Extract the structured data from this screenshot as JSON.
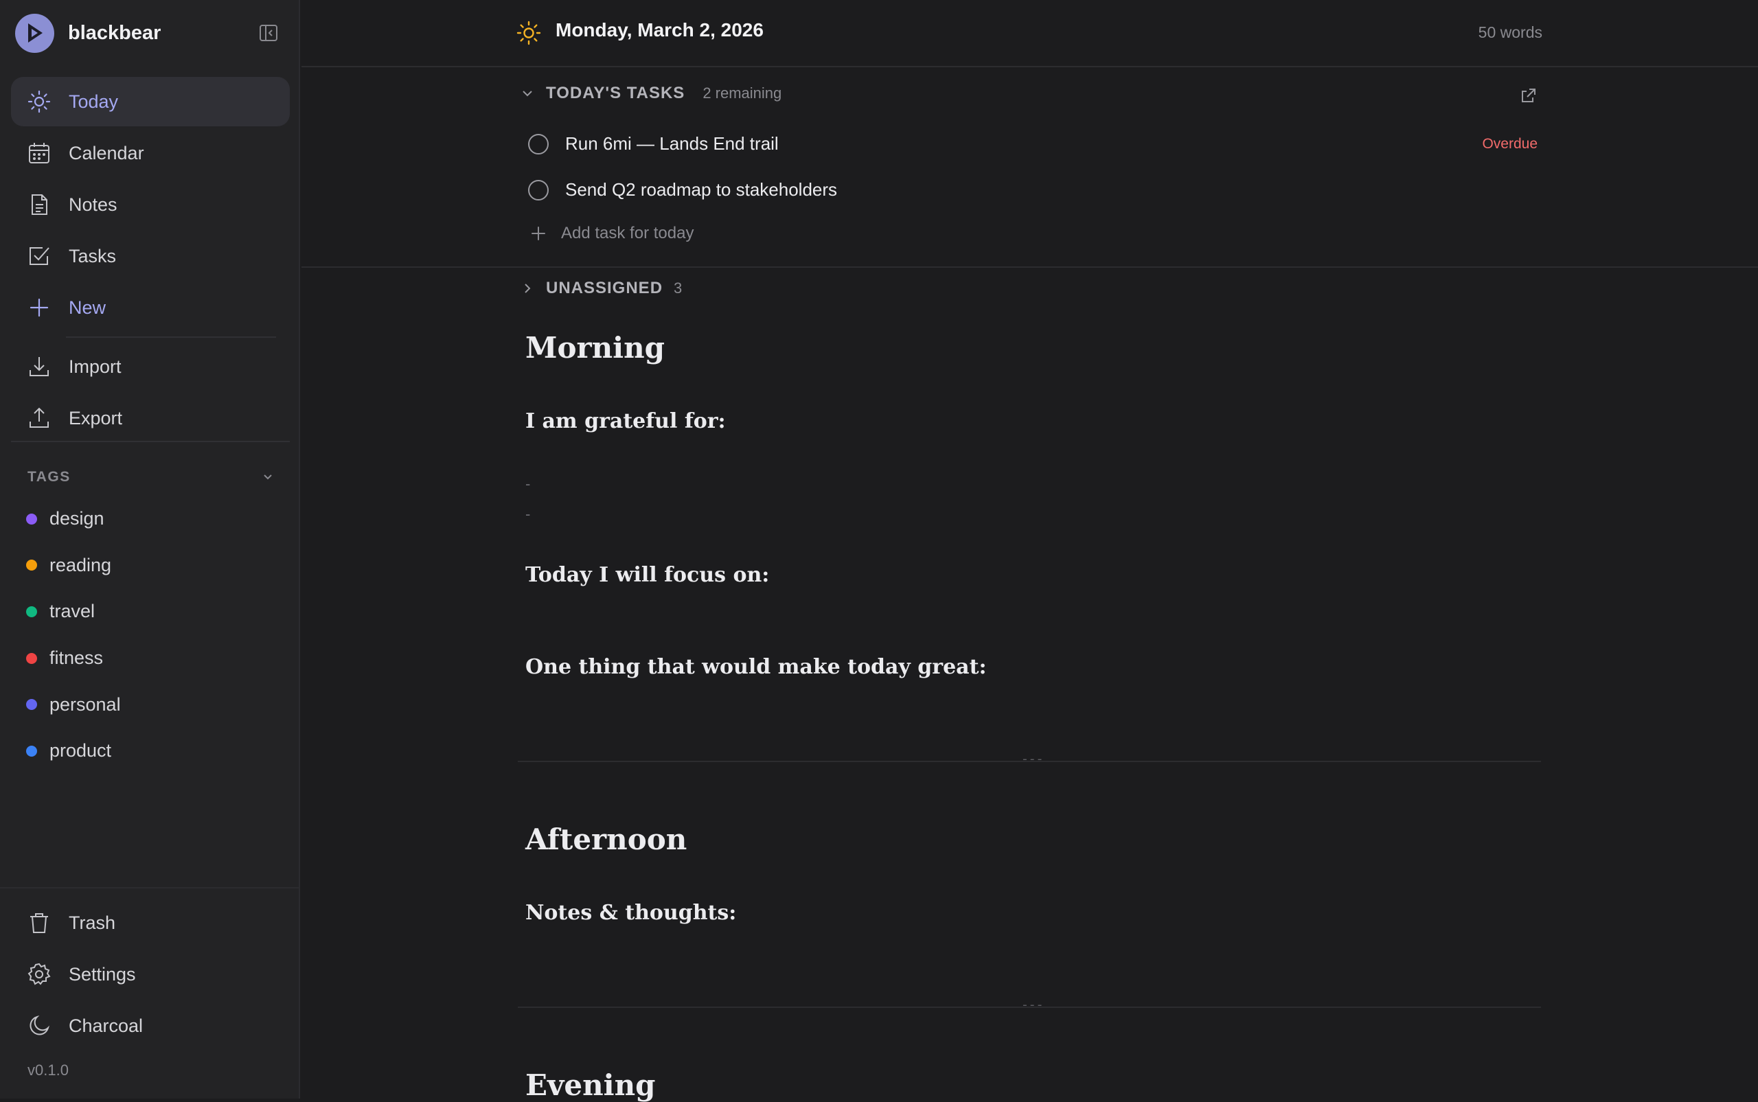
{
  "app": {
    "name": "blackbear",
    "version": "v0.1.0"
  },
  "sidebar": {
    "nav": [
      {
        "label": "Today",
        "icon": "sun-icon",
        "active": true
      },
      {
        "label": "Calendar",
        "icon": "calendar-icon"
      },
      {
        "label": "Notes",
        "icon": "document-icon"
      },
      {
        "label": "Tasks",
        "icon": "checkbox-icon"
      },
      {
        "label": "New",
        "icon": "plus-icon"
      },
      {
        "label": "Import",
        "icon": "download-icon"
      },
      {
        "label": "Export",
        "icon": "upload-icon"
      }
    ],
    "tags_header": "TAGS",
    "tags": [
      {
        "label": "design",
        "color": "#8b5cf6"
      },
      {
        "label": "reading",
        "color": "#f59e0b"
      },
      {
        "label": "travel",
        "color": "#10b981"
      },
      {
        "label": "fitness",
        "color": "#ef4444"
      },
      {
        "label": "personal",
        "color": "#6366f1"
      },
      {
        "label": "product",
        "color": "#3b82f6"
      }
    ],
    "bottom": [
      {
        "label": "Trash",
        "icon": "trash-icon"
      },
      {
        "label": "Settings",
        "icon": "gear-icon"
      },
      {
        "label": "Charcoal",
        "icon": "moon-icon"
      }
    ]
  },
  "header": {
    "date": "Monday, March 2, 2026",
    "word_count": "50 words"
  },
  "todays_tasks": {
    "label": "TODAY'S TASKS",
    "count": "2 remaining",
    "items": [
      {
        "text": "Run 6mi — Lands End trail",
        "status": "Overdue"
      },
      {
        "text": "Send Q2 roadmap to stakeholders",
        "status": ""
      }
    ],
    "add_placeholder": "Add task for today"
  },
  "unassigned": {
    "label": "UNASSIGNED",
    "count": "3"
  },
  "document": {
    "morning": "Morning",
    "grateful": "I am grateful for:",
    "bullet1": "-",
    "bullet2": "-",
    "focus": "Today I will focus on:",
    "great": "One thing that would make today great:",
    "hr": "---",
    "afternoon": "Afternoon",
    "notes": "Notes & thoughts:",
    "evening": "Evening"
  },
  "colors": {
    "accent": "#a5a9f2",
    "overdue": "#f26b6b",
    "background": "#1c1c1e",
    "sidebar": "#232325"
  }
}
